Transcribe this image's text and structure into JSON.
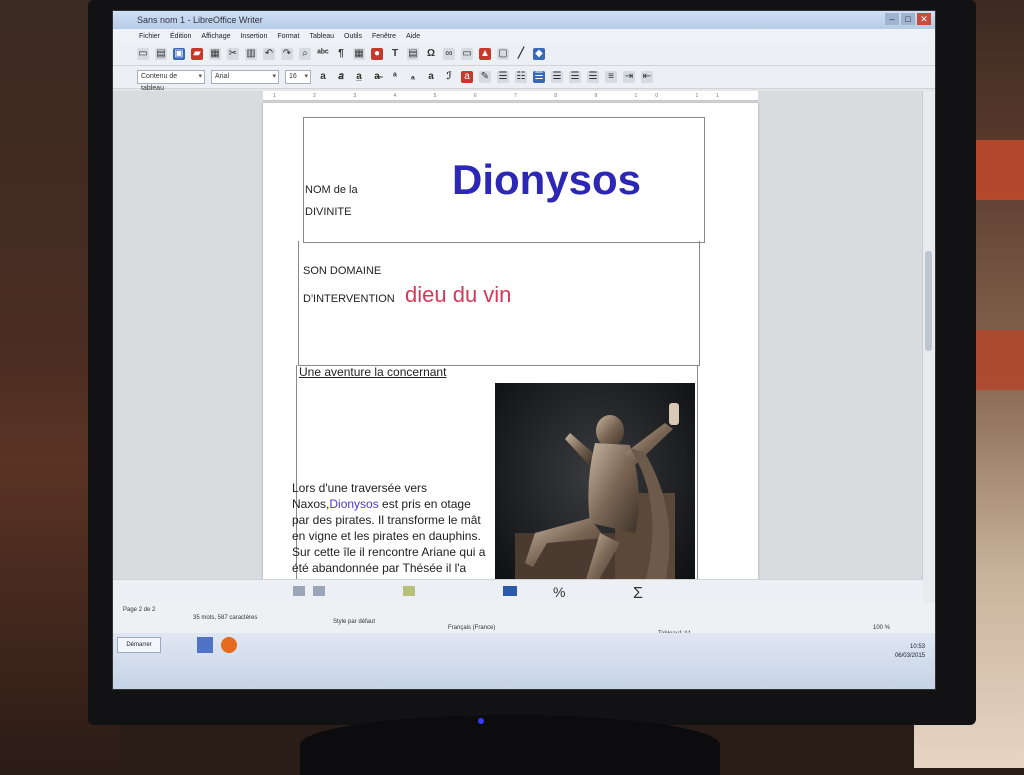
{
  "window": {
    "title": "Sans nom 1 - LibreOffice Writer",
    "buttons": [
      "–",
      "□",
      "✕"
    ]
  },
  "menu": [
    "Fichier",
    "Édition",
    "Affichage",
    "Insertion",
    "Format",
    "Tableau",
    "Outils",
    "Fenêtre",
    "Aide"
  ],
  "format_bar": {
    "style_value": "Contenu de tableau",
    "font_value": "Arial",
    "size_value": "16"
  },
  "document": {
    "row1": {
      "label_line1": "NOM de la",
      "label_line2": "DIVINITE",
      "value": "Dionysos"
    },
    "row2": {
      "label_line1": "SON DOMAINE",
      "label_line2": "D'INTERVENTION",
      "value": "dieu du vin"
    },
    "row3": {
      "heading": "Une aventure la concernant",
      "story_before": "Lors d'une traversée vers Naxos,",
      "story_highlight": "Dionysos",
      "story_after": " est pris en otage par des pirates. Il transforme le mât en vigne et les pirates en dauphins. Sur cette île il rencontre Ariane qui a été abandonnée par Thésée il l'a recueilli et l'emmène sur l'Olympe."
    }
  },
  "status": {
    "page": "Page 2 de 2",
    "words": "35 mots, 587 caractères",
    "style": "Style par défaut",
    "language": "Français (France)",
    "cell": "Tableau1:A1",
    "zoom": "100 %"
  },
  "taskbar": {
    "start_label": "Démarrer",
    "time": "10:53",
    "date": "06/03/2015"
  },
  "colors": {
    "title_blue": "#2d27b6",
    "domain_red": "#d5385a"
  }
}
